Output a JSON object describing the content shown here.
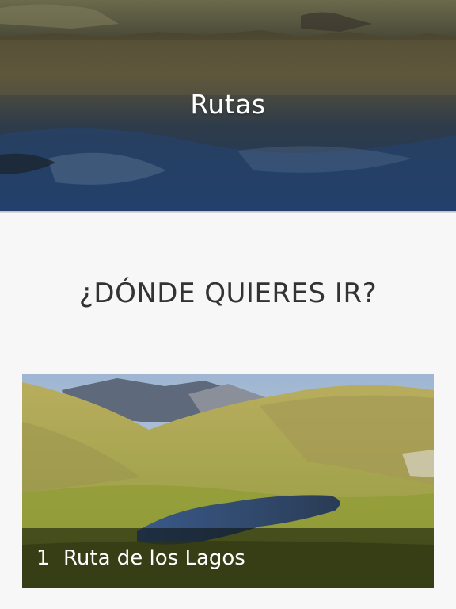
{
  "header": {
    "title": "Rutas"
  },
  "main": {
    "question": "¿DÓNDE QUIERES IR?",
    "routes": [
      {
        "number": "1",
        "name": "Ruta de los Lagos"
      }
    ]
  }
}
